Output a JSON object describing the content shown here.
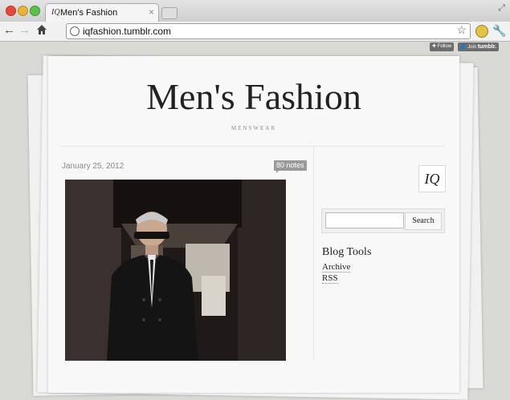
{
  "browser": {
    "tab": {
      "favicon_text": "IQ",
      "title": "Men's Fashion"
    },
    "address": {
      "url": "iqfashion.tumblr.com"
    },
    "icons": [
      "back-icon",
      "forward-icon",
      "home-icon",
      "globe-icon",
      "star-icon",
      "extension-icon",
      "wrench-icon",
      "close-icon"
    ]
  },
  "tumblr_controls": {
    "follow_label": "Follow",
    "join_label_prefix": "Join",
    "join_label_brand": "tumblr."
  },
  "blog": {
    "title": "Men's Fashion",
    "description": "MENSWEAR",
    "post": {
      "date": "January 25, 2012",
      "notes": "80 notes"
    },
    "sidebar": {
      "logo_text": "IQ",
      "search_button": "Search",
      "tools_title": "Blog Tools",
      "links": [
        "Archive",
        "RSS"
      ]
    }
  },
  "colors": {
    "background": "#d9d9d6",
    "paper": "#f8f8f8",
    "notes_badge": "#9a9a9a"
  }
}
